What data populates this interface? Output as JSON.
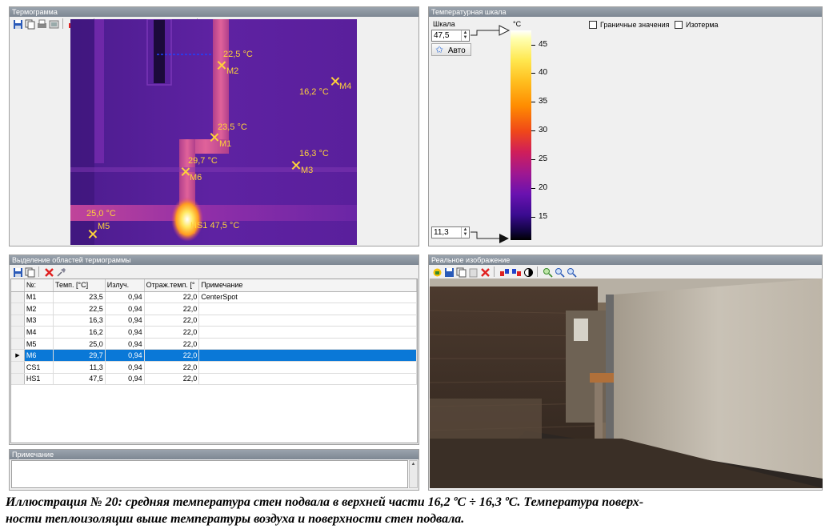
{
  "thermogram": {
    "title": "Термограмма",
    "markers": [
      {
        "id": "M1",
        "temp": "23,5 °C"
      },
      {
        "id": "M2",
        "temp": "22,5 °C"
      },
      {
        "id": "M3",
        "temp": "16,3 °C"
      },
      {
        "id": "M4",
        "temp": "16,2 °C"
      },
      {
        "id": "M5",
        "temp": "25,0 °C"
      },
      {
        "id": "M6",
        "temp": "29,7 °C"
      },
      {
        "id": "HS1",
        "temp": "HS1 47,5 °C"
      }
    ]
  },
  "scale": {
    "title": "Температурная шкала",
    "label": "Шкала",
    "max_value": "47,5",
    "min_value": "11,3",
    "auto_button": "Авто",
    "unit": "°C",
    "ticks": [
      "45",
      "40",
      "35",
      "30",
      "25",
      "20",
      "15"
    ],
    "boundary_checkbox": "Граничные значения",
    "isotherm_checkbox": "Изотерма"
  },
  "regions": {
    "title": "Выделение областей термограммы",
    "columns": [
      "№:",
      "Темп. [°C]",
      "Излуч.",
      "Отраж.темп. [°",
      "Примечание"
    ],
    "rows": [
      {
        "id": "M1",
        "temp": "23,5",
        "emis": "0,94",
        "refl": "22,0",
        "note": "CenterSpot",
        "selected": false
      },
      {
        "id": "M2",
        "temp": "22,5",
        "emis": "0,94",
        "refl": "22,0",
        "note": "",
        "selected": false
      },
      {
        "id": "M3",
        "temp": "16,3",
        "emis": "0,94",
        "refl": "22,0",
        "note": "",
        "selected": false
      },
      {
        "id": "M4",
        "temp": "16,2",
        "emis": "0,94",
        "refl": "22,0",
        "note": "",
        "selected": false
      },
      {
        "id": "M5",
        "temp": "25,0",
        "emis": "0,94",
        "refl": "22,0",
        "note": "",
        "selected": false
      },
      {
        "id": "M6",
        "temp": "29,7",
        "emis": "0,94",
        "refl": "22,0",
        "note": "",
        "selected": true
      },
      {
        "id": "CS1",
        "temp": "11,3",
        "emis": "0,94",
        "refl": "22,0",
        "note": "",
        "selected": false
      },
      {
        "id": "HS1",
        "temp": "47,5",
        "emis": "0,94",
        "refl": "22,0",
        "note": "",
        "selected": false
      }
    ]
  },
  "notes": {
    "title": "Примечание",
    "value": ""
  },
  "photo": {
    "title": "Реальное изображение"
  },
  "caption": {
    "line1": "Иллюстрация № 20: средняя температура стен подвала в верхней части 16,2 ºC ÷ 16,3 ºC. Температура поверх-",
    "line2": "ности теплоизоляции выше температуры воздуха и поверхности стен подвала."
  }
}
